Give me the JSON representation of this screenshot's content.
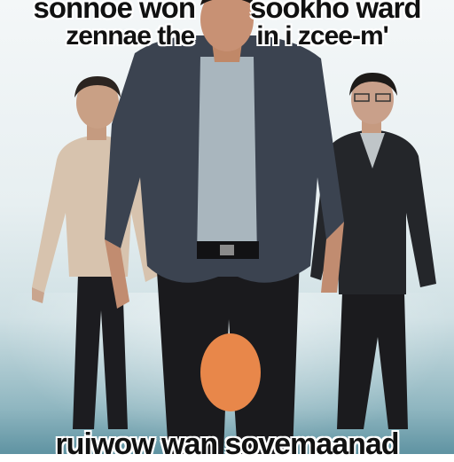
{
  "caption": {
    "top_line_1_left": "sonnoe won",
    "top_line_1_right": "sookho ward",
    "top_line_2_left": "zennae the",
    "top_line_2_right": "in i zcee-m'",
    "bottom_line": "ruiwow wan sovemaanad"
  },
  "colors": {
    "jacket": "#3b4350",
    "shirt_center": "#a9b6be",
    "pants": "#1a1a1d",
    "left_shirt": "#d7c3ae",
    "right_jacket": "#24262a",
    "orange_shape": "#e8874a",
    "background_top": "#f4f7f8",
    "background_bottom": "#5f93a2"
  }
}
